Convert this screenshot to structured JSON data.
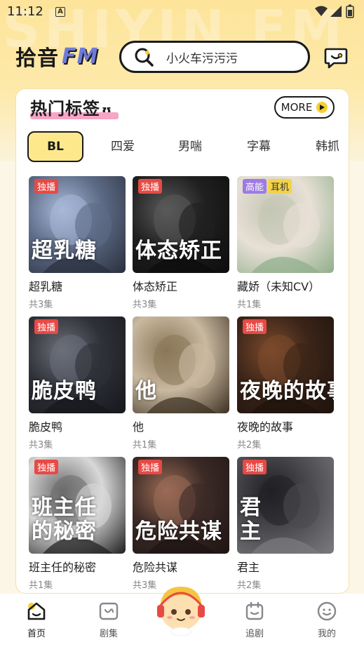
{
  "status_bar": {
    "time": "11:12",
    "notice_icon": "A"
  },
  "header": {
    "logo_cn": "拾音",
    "logo_fm": "FM",
    "watermark": "SHIYIN FM",
    "search_placeholder": "小火车污污污"
  },
  "tags_section": {
    "title": "热门标签",
    "more_label": "MORE",
    "tabs": [
      "BL",
      "四爱",
      "男喘",
      "字幕",
      "韩抓"
    ],
    "active_tab": "BL"
  },
  "items": [
    {
      "title": "超乳糖",
      "eps": "共3集",
      "cover_text": "超乳糖",
      "badges": [
        "独播"
      ],
      "colors": [
        "#5d6b86",
        "#a8b8d8",
        "#2a2f3d"
      ]
    },
    {
      "title": "体态矫正",
      "eps": "共3集",
      "cover_text": "体态矫正",
      "badges": [
        "独播"
      ],
      "colors": [
        "#202020",
        "#5a5a5a",
        "#0c0c0c"
      ]
    },
    {
      "title": "藏娇（未知CV）",
      "eps": "共1集",
      "cover_text": "",
      "badges": [
        "高能",
        "耳机"
      ],
      "colors": [
        "#e8e0d6",
        "#c4c6b4",
        "#8fae8a"
      ]
    },
    {
      "title": "脆皮鸭",
      "eps": "共3集",
      "cover_text": "脆皮鸭",
      "badges": [
        "独播"
      ],
      "colors": [
        "#2f3138",
        "#6c6f7a",
        "#15171c"
      ]
    },
    {
      "title": "他",
      "eps": "共1集",
      "cover_text": "他",
      "badges": [],
      "colors": [
        "#c9b9a0",
        "#8a7658",
        "#3c3022"
      ]
    },
    {
      "title": "夜晚的故事",
      "eps": "共2集",
      "cover_text": "夜晚的故事",
      "badges": [
        "独播"
      ],
      "colors": [
        "#3a2418",
        "#7b4a2c",
        "#1c120c"
      ]
    },
    {
      "title": "班主任的秘密",
      "eps": "共1集",
      "cover_text": "班主任\n的秘密",
      "badges": [
        "独播"
      ],
      "colors": [
        "#d8d8d8",
        "#6b6b6b",
        "#1e1e1e"
      ]
    },
    {
      "title": "危险共谋",
      "eps": "共3集",
      "cover_text": "危险共谋",
      "badges": [
        "独播"
      ],
      "colors": [
        "#3b2a26",
        "#9a6b55",
        "#1d1412"
      ]
    },
    {
      "title": "君主",
      "eps": "共2集",
      "cover_text": "君\n主",
      "badges": [
        "独播"
      ],
      "colors": [
        "#4b4b4f",
        "#202024",
        "#7c7c80"
      ]
    }
  ],
  "bottom_nav": {
    "items": [
      {
        "label": "首页",
        "icon": "home-icon",
        "active": true
      },
      {
        "label": "剧集",
        "icon": "drama-icon",
        "active": false
      },
      {
        "label": "追剧",
        "icon": "follow-icon",
        "active": false
      },
      {
        "label": "我的",
        "icon": "profile-icon",
        "active": false
      }
    ]
  },
  "accent_colors": {
    "yellow": "#fde98c",
    "red_badge": "#e74a45",
    "pink": "#f6a5c4"
  }
}
